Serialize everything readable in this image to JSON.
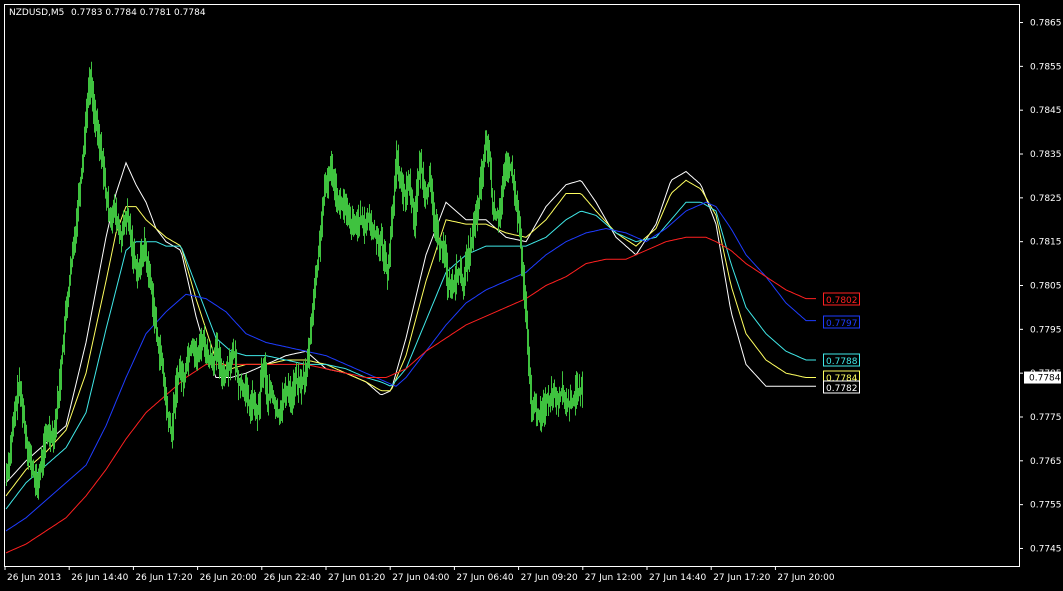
{
  "header": {
    "symbol": "NZDUSD,M5",
    "ohlc": "0.7783 0.7784 0.7781 0.7784"
  },
  "colors": {
    "background": "#000000",
    "price": "#3fc23f",
    "axis": "#ffffff",
    "ma_white": "#ffffff",
    "ma_yellow": "#ffff60",
    "ma_cyan": "#40e8e8",
    "ma_blue": "#1e3cff",
    "ma_red": "#ff2020"
  },
  "chart_data": {
    "type": "line",
    "title": "NZDUSD,M5",
    "ylim": [
      0.7741,
      0.7869
    ],
    "y_ticks": [
      "0.7865",
      "0.7855",
      "0.7845",
      "0.7835",
      "0.7825",
      "0.7815",
      "0.7805",
      "0.7795",
      "0.7785",
      "0.7775",
      "0.7765",
      "0.7755",
      "0.7745"
    ],
    "x_labels": [
      "26 Jun 2013",
      "26 Jun 14:40",
      "26 Jun 17:20",
      "26 Jun 20:00",
      "26 Jun 22:40",
      "27 Jun 01:20",
      "27 Jun 04:00",
      "27 Jun 06:40",
      "27 Jun 09:20",
      "27 Jun 12:00",
      "27 Jun 14:40",
      "27 Jun 17:20",
      "27 Jun 20:00"
    ],
    "current_price": "0.7784",
    "price_series": {
      "name": "NZDUSD",
      "x": [
        0,
        3,
        6,
        9,
        12,
        15,
        18,
        21,
        24,
        27,
        30,
        33,
        36,
        39,
        42,
        45,
        48,
        51,
        54,
        57,
        60,
        63,
        66,
        69,
        72,
        75,
        78,
        81,
        84,
        87,
        90,
        93,
        96,
        99,
        102,
        105,
        108,
        111,
        114,
        117,
        120,
        123,
        126,
        129,
        132,
        135,
        138,
        141,
        144,
        147,
        150,
        153,
        156,
        159,
        162,
        165,
        168,
        171,
        174,
        177,
        180,
        183,
        186,
        189,
        192,
        195,
        198,
        201,
        204,
        207,
        210,
        213,
        216,
        219,
        222,
        225,
        228,
        231,
        234,
        237,
        240,
        243,
        246,
        249,
        252,
        255,
        258,
        261,
        264,
        267,
        270,
        273,
        276,
        279,
        282,
        285,
        288,
        291,
        294,
        297,
        300,
        303,
        306,
        309,
        312,
        315,
        318,
        321,
        324,
        327,
        330,
        333,
        336,
        339,
        342,
        345,
        348,
        351,
        354,
        357,
        360,
        363,
        366,
        369,
        372,
        375,
        378,
        381,
        384,
        387,
        390,
        393,
        396,
        399,
        402,
        405,
        408,
        411,
        414,
        417,
        420,
        423,
        426,
        429,
        432,
        435,
        438,
        441,
        444,
        447,
        450,
        453,
        456,
        459,
        462,
        465,
        468,
        471,
        474,
        477,
        480,
        483,
        486,
        489,
        492,
        495,
        498,
        501,
        504,
        507,
        510,
        513,
        516,
        519,
        522,
        525,
        528,
        531,
        534,
        537,
        540,
        543,
        546,
        549,
        552,
        555,
        558,
        561,
        564,
        567,
        570,
        573,
        576,
        579,
        582,
        585,
        588,
        591,
        594,
        597,
        600,
        603,
        606,
        609,
        612,
        615,
        618,
        621,
        624,
        627,
        630,
        633,
        636,
        639,
        642,
        645,
        648,
        651,
        654,
        657,
        660,
        663,
        666,
        669,
        672,
        675,
        678,
        681,
        684,
        687,
        690,
        693,
        696,
        699,
        702,
        705,
        708,
        711,
        714,
        717,
        720,
        723,
        726,
        729,
        732,
        735,
        738,
        741,
        744,
        747,
        750,
        753,
        756,
        759,
        762,
        765,
        768,
        771,
        774,
        777,
        780,
        783,
        786,
        789,
        792,
        795,
        798,
        801,
        804,
        807,
        810
      ],
      "y": [
        0.7762,
        0.7766,
        0.7772,
        0.7777,
        0.7782,
        0.7779,
        0.7773,
        0.7768,
        0.7765,
        0.7762,
        0.7759,
        0.7762,
        0.7766,
        0.777,
        0.7772,
        0.7771,
        0.7772,
        0.7778,
        0.7785,
        0.7793,
        0.78,
        0.7806,
        0.7812,
        0.7818,
        0.7825,
        0.7831,
        0.7839,
        0.7848,
        0.7852,
        0.7846,
        0.7841,
        0.7837,
        0.7834,
        0.7826,
        0.7822,
        0.7821,
        0.7822,
        0.7819,
        0.7816,
        0.7818,
        0.7821,
        0.7818,
        0.7813,
        0.781,
        0.7808,
        0.7812,
        0.7814,
        0.7809,
        0.7806,
        0.78,
        0.7794,
        0.779,
        0.7786,
        0.7779,
        0.7774,
        0.7771,
        0.7779,
        0.7784,
        0.7786,
        0.7783,
        0.7788,
        0.779,
        0.7792,
        0.7789,
        0.7789,
        0.7793,
        0.7792,
        0.7788,
        0.7789,
        0.7788,
        0.779,
        0.7787,
        0.7785,
        0.7785,
        0.7787,
        0.7789,
        0.7789,
        0.7784,
        0.7782,
        0.7782,
        0.778,
        0.7777,
        0.7779,
        0.7776,
        0.7776,
        0.7785,
        0.7786,
        0.7779,
        0.7781,
        0.7779,
        0.7776,
        0.7776,
        0.7779,
        0.778,
        0.7782,
        0.7779,
        0.7783,
        0.7783,
        0.7782,
        0.7784,
        0.7785,
        0.7792,
        0.78,
        0.7806,
        0.7812,
        0.782,
        0.7826,
        0.7829,
        0.7832,
        0.783,
        0.7826,
        0.7823,
        0.7824,
        0.7822,
        0.782,
        0.7819,
        0.7818,
        0.782,
        0.782,
        0.7818,
        0.782,
        0.782,
        0.7817,
        0.7817,
        0.7815,
        0.7815,
        0.7811,
        0.7808,
        0.7816,
        0.7824,
        0.7835,
        0.783,
        0.7826,
        0.7826,
        0.7829,
        0.7825,
        0.782,
        0.7828,
        0.7833,
        0.7828,
        0.7826,
        0.7829,
        0.7823,
        0.7818,
        0.7815,
        0.7814,
        0.7813,
        0.7806,
        0.7805,
        0.7804,
        0.7808,
        0.7808,
        0.7805,
        0.7809,
        0.7812,
        0.7815,
        0.7819,
        0.7822,
        0.7828,
        0.7833,
        0.7838,
        0.7834,
        0.7823,
        0.7821,
        0.7821,
        0.7825,
        0.783,
        0.7832,
        0.7832,
        0.7828,
        0.7823,
        0.7818,
        0.7808,
        0.78,
        0.7787,
        0.7778,
        0.7777,
        0.7776,
        0.7775,
        0.7777,
        0.7779,
        0.7779,
        0.7781,
        0.778,
        0.7779,
        0.7781,
        0.7779,
        0.7778,
        0.7778,
        0.7779,
        0.7781,
        0.7781,
        0.7781
      ]
    },
    "series": [
      {
        "name": "",
        "color": "ma_white",
        "x": [
          0,
          20,
          40,
          60,
          80,
          100,
          110,
          120,
          130,
          140,
          150,
          160,
          175,
          190,
          200,
          210,
          225,
          240,
          260,
          280,
          300,
          320,
          340,
          360,
          375,
          385,
          400,
          420,
          440,
          460,
          480,
          500,
          520,
          540,
          560,
          575,
          590,
          610,
          630,
          650,
          665,
          680,
          695,
          710,
          725,
          740,
          760,
          780,
          800,
          810
        ],
        "y": [
          0.776,
          0.7765,
          0.7769,
          0.7773,
          0.7792,
          0.7816,
          0.7826,
          0.7833,
          0.7828,
          0.7824,
          0.7818,
          0.7815,
          0.7813,
          0.7798,
          0.779,
          0.7784,
          0.7784,
          0.7785,
          0.7787,
          0.7789,
          0.779,
          0.7786,
          0.7785,
          0.7783,
          0.778,
          0.7781,
          0.7793,
          0.7812,
          0.7824,
          0.782,
          0.782,
          0.7816,
          0.7815,
          0.7823,
          0.7828,
          0.7829,
          0.7824,
          0.7816,
          0.7812,
          0.7819,
          0.7829,
          0.7831,
          0.7828,
          0.7819,
          0.7799,
          0.7787,
          0.7782,
          0.7782,
          0.7782,
          0.7782
        ]
      },
      {
        "name": "",
        "color": "ma_yellow",
        "x": [
          0,
          20,
          40,
          60,
          80,
          100,
          110,
          120,
          130,
          140,
          150,
          160,
          175,
          190,
          200,
          210,
          225,
          240,
          260,
          280,
          300,
          320,
          340,
          360,
          375,
          385,
          400,
          420,
          440,
          460,
          480,
          500,
          520,
          540,
          560,
          575,
          590,
          610,
          630,
          650,
          665,
          680,
          695,
          710,
          725,
          740,
          760,
          780,
          800,
          810
        ],
        "y": [
          0.7757,
          0.7763,
          0.7767,
          0.7772,
          0.7785,
          0.7806,
          0.7817,
          0.7823,
          0.7823,
          0.782,
          0.7818,
          0.7816,
          0.7814,
          0.7802,
          0.7795,
          0.7788,
          0.7786,
          0.7787,
          0.7787,
          0.7788,
          0.7788,
          0.7787,
          0.7785,
          0.7783,
          0.7781,
          0.7781,
          0.7789,
          0.7806,
          0.782,
          0.7819,
          0.7819,
          0.7817,
          0.7816,
          0.782,
          0.7826,
          0.7826,
          0.7822,
          0.7817,
          0.7814,
          0.7818,
          0.7826,
          0.7829,
          0.7827,
          0.7821,
          0.7805,
          0.7794,
          0.7788,
          0.7785,
          0.7784,
          0.7784
        ]
      },
      {
        "name": "",
        "color": "ma_cyan",
        "x": [
          0,
          20,
          40,
          60,
          80,
          100,
          110,
          120,
          130,
          140,
          150,
          160,
          175,
          190,
          200,
          210,
          225,
          240,
          260,
          280,
          300,
          320,
          340,
          360,
          375,
          385,
          400,
          420,
          440,
          460,
          480,
          500,
          520,
          540,
          560,
          575,
          590,
          610,
          630,
          650,
          665,
          680,
          695,
          710,
          725,
          740,
          760,
          780,
          800,
          810
        ],
        "y": [
          0.7754,
          0.776,
          0.7764,
          0.7768,
          0.7776,
          0.7795,
          0.7804,
          0.7813,
          0.7815,
          0.7815,
          0.7815,
          0.7814,
          0.7814,
          0.7805,
          0.7799,
          0.7793,
          0.779,
          0.7789,
          0.7789,
          0.7788,
          0.7787,
          0.7787,
          0.7786,
          0.7784,
          0.7783,
          0.7782,
          0.7786,
          0.7797,
          0.7808,
          0.7812,
          0.7814,
          0.7814,
          0.7814,
          0.7816,
          0.782,
          0.7822,
          0.7821,
          0.7817,
          0.7815,
          0.7816,
          0.782,
          0.7824,
          0.7824,
          0.7822,
          0.781,
          0.78,
          0.7794,
          0.779,
          0.7788,
          0.7788
        ]
      },
      {
        "name": "",
        "color": "ma_blue",
        "x": [
          0,
          20,
          40,
          60,
          80,
          100,
          120,
          140,
          160,
          180,
          200,
          220,
          240,
          260,
          280,
          300,
          320,
          340,
          360,
          380,
          390,
          400,
          420,
          440,
          460,
          480,
          500,
          520,
          540,
          560,
          580,
          600,
          620,
          640,
          660,
          680,
          700,
          710,
          725,
          740,
          760,
          780,
          800,
          810
        ],
        "y": [
          0.7749,
          0.7752,
          0.7756,
          0.776,
          0.7764,
          0.7773,
          0.7784,
          0.7794,
          0.7799,
          0.7803,
          0.7802,
          0.7799,
          0.7794,
          0.7792,
          0.7791,
          0.779,
          0.7789,
          0.7787,
          0.7785,
          0.7783,
          0.7782,
          0.7784,
          0.779,
          0.7796,
          0.7801,
          0.7804,
          0.7806,
          0.7808,
          0.7812,
          0.7815,
          0.7817,
          0.7818,
          0.7817,
          0.7815,
          0.7818,
          0.7822,
          0.7824,
          0.7823,
          0.7818,
          0.7812,
          0.7807,
          0.7801,
          0.7797,
          0.7797
        ]
      },
      {
        "name": "",
        "color": "ma_red",
        "x": [
          0,
          20,
          40,
          60,
          80,
          100,
          120,
          140,
          160,
          180,
          200,
          220,
          240,
          260,
          280,
          300,
          320,
          340,
          360,
          380,
          390,
          400,
          420,
          440,
          460,
          480,
          500,
          520,
          540,
          560,
          580,
          600,
          620,
          640,
          660,
          680,
          700,
          710,
          725,
          740,
          760,
          780,
          800,
          810
        ],
        "y": [
          0.7744,
          0.7746,
          0.7749,
          0.7752,
          0.7757,
          0.7763,
          0.777,
          0.7776,
          0.778,
          0.7784,
          0.7787,
          0.7787,
          0.7787,
          0.7787,
          0.7787,
          0.7787,
          0.7786,
          0.7785,
          0.7784,
          0.7784,
          0.7785,
          0.7786,
          0.779,
          0.7793,
          0.7796,
          0.7798,
          0.78,
          0.7802,
          0.7805,
          0.7807,
          0.781,
          0.7811,
          0.7811,
          0.7813,
          0.7815,
          0.7816,
          0.7816,
          0.7815,
          0.7813,
          0.781,
          0.7807,
          0.7804,
          0.7802,
          0.7802
        ]
      }
    ],
    "line_labels": [
      {
        "text": "0.7802",
        "color": "ma_red",
        "value": 0.7802
      },
      {
        "text": "0.7797",
        "color": "ma_blue",
        "value": 0.7797
      },
      {
        "text": "0.7788",
        "color": "ma_cyan",
        "value": 0.7788
      },
      {
        "text": "0.7784",
        "color": "ma_yellow",
        "value": 0.7784
      },
      {
        "text": "0.7782",
        "color": "ma_white",
        "value": 0.7782
      }
    ]
  }
}
